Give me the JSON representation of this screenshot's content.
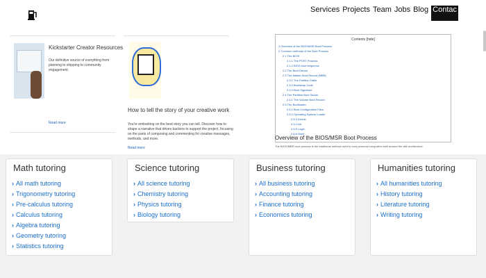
{
  "header": {
    "logo_icon": "fuel-pump-icon",
    "nav": [
      {
        "label": "Services"
      },
      {
        "label": "Projects"
      },
      {
        "label": "Team"
      },
      {
        "label": "Jobs"
      },
      {
        "label": "Blog"
      },
      {
        "label": "Contac"
      }
    ]
  },
  "preview_left": {
    "card1": {
      "title": "Kickstarter Creator Resources",
      "body": "Our definitive source of everything from planning to shipping to community engagement.",
      "link": "Read more"
    },
    "card2": {
      "title": "How to tell the story of your creative work",
      "body": "You're embarking on the best story you can tell. Discover how to shape a narrative that drives backers to support the project, focusing on the parts of composing and commenting for creative messages, methods, and more.",
      "link": "Read more"
    }
  },
  "preview_right": {
    "toc_title": "Contents [hide]",
    "toc_lines": [
      "1 Overview of the BIOS/MSR Boot Process",
      "2 Common methods of the Boot Process",
      "2.1 The BIOS",
      "2.1.1 The POST Process",
      "2.1.2 BIOS boot sequence",
      "2.2 The Boot Device",
      "2.3 The Master Boot Record (MBR)",
      "2.3.1 The Partition Table",
      "2.3.2 Bootstrap Code",
      "2.3.3 Boot Signature",
      "2.4 The Partition Boot Sector",
      "2.4.1 The Volume Boot Record",
      "2.5 The Bootloader",
      "2.5.1 Boot Configuration Files",
      "2.5.2 Operating System Loader",
      "2.5.3 Kernel",
      "2.5.4 Init",
      "2.5.5 Login",
      "2.5.6 Shell"
    ],
    "caption": "Overview of the BIOS/MSR Boot Process",
    "description": "The BIOS/MBR boot process is the traditional method used to boot personal computers built around the x86 architecture."
  },
  "categories": [
    {
      "title": "Math tutoring",
      "items": [
        "All math tutoring",
        "Trigonometry tutoring",
        "Pre-calculus tutoring",
        "Calculus tutoring",
        "Algebra tutoring",
        "Geometry tutoring",
        "Statistics tutoring"
      ]
    },
    {
      "title": "Science tutoring",
      "items": [
        "All science tutoring",
        "Chemistry tutoring",
        "Physics tutoring",
        "Biology tutoring"
      ]
    },
    {
      "title": "Business tutoring",
      "items": [
        "All business tutoring",
        "Accounting tutoring",
        "Finance tutoring",
        "Economics tutoring"
      ]
    },
    {
      "title": "Humanities tutoring",
      "items": [
        "All humanities tutoring",
        "History tutoring",
        "Literature tutoring",
        "Writing tutoring"
      ]
    }
  ],
  "colors": {
    "link": "#1a6fc9",
    "card_border": "#dddddd",
    "section_bg": "#f2f2f2"
  }
}
